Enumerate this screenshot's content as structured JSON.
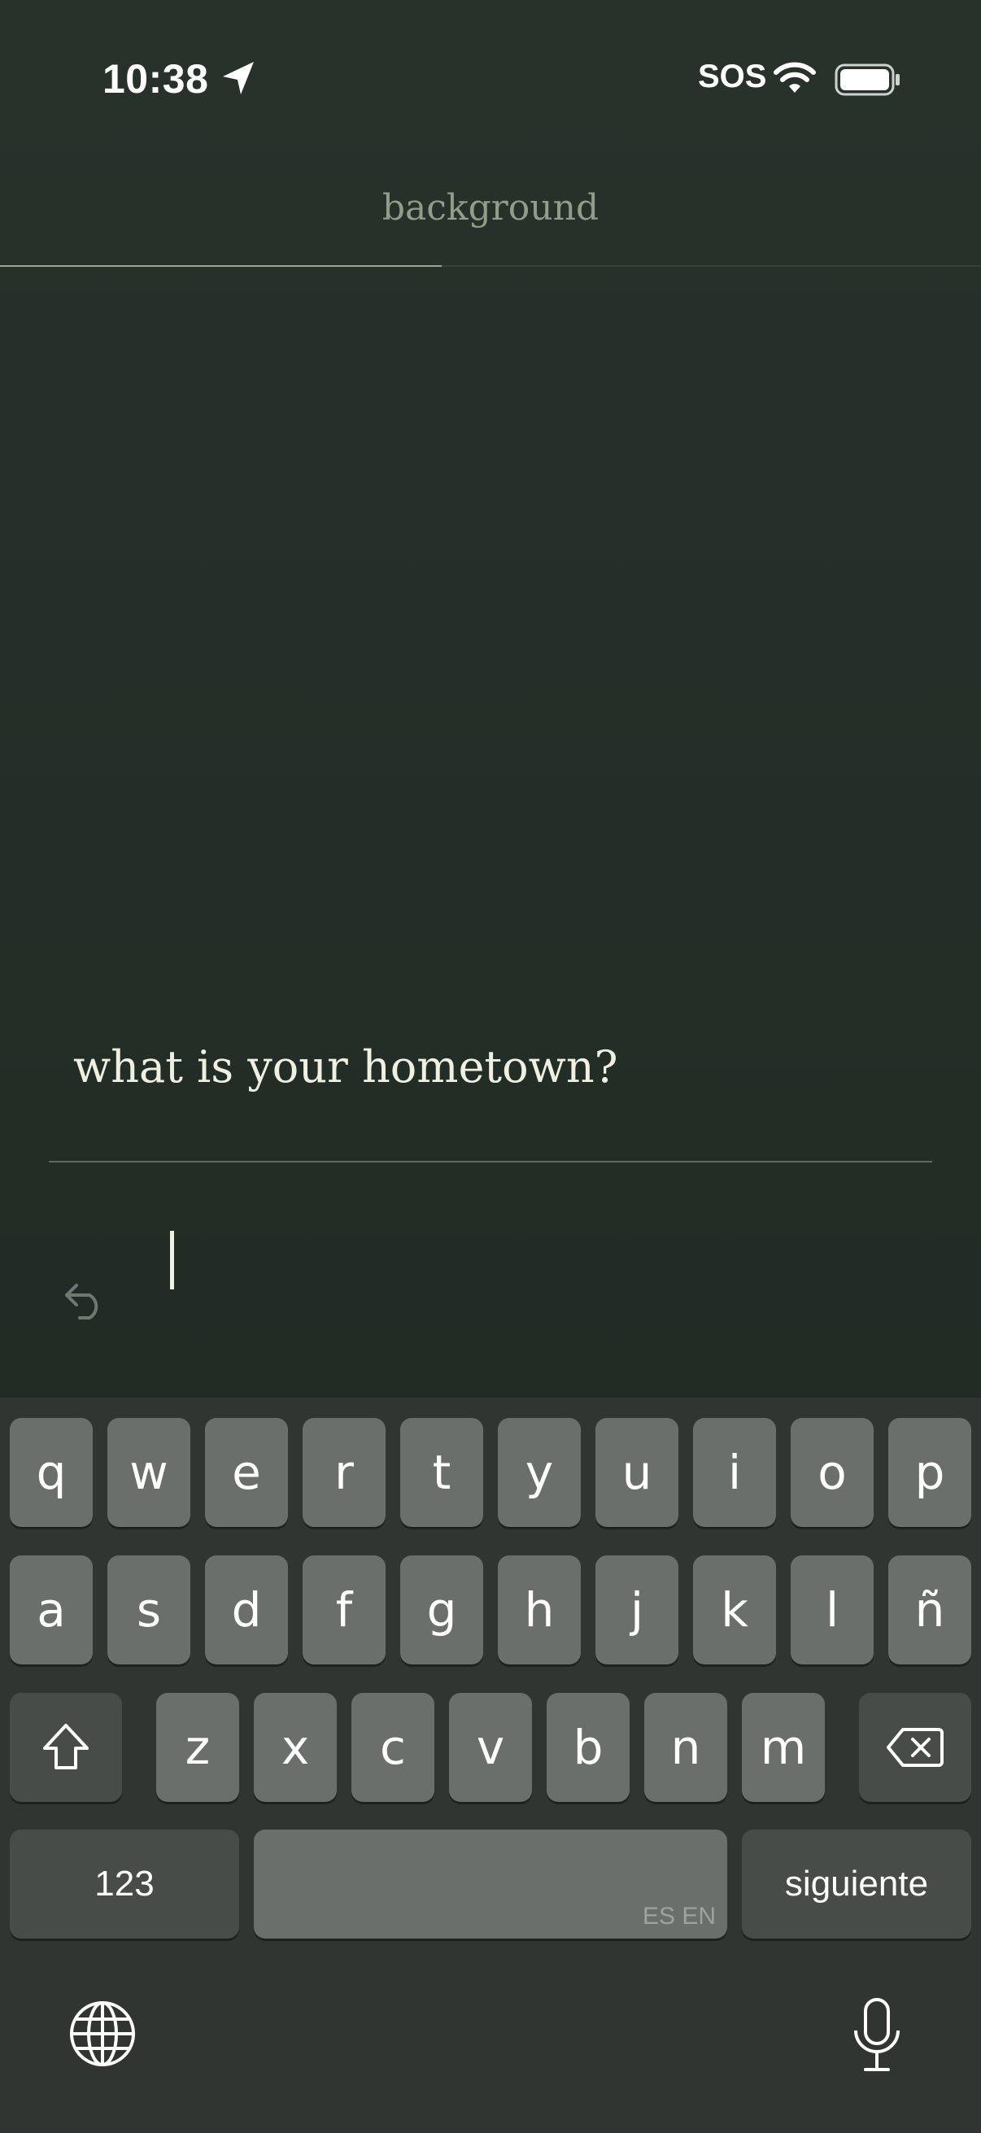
{
  "status_bar": {
    "time": "10:38",
    "sos": "SOS",
    "location_icon": "location-arrow-icon",
    "wifi_icon": "wifi-icon",
    "battery_icon": "battery-icon"
  },
  "header": {
    "title": "background",
    "progress": 0.45
  },
  "question": {
    "text": "what is your hometown?"
  },
  "answer": {
    "value": "",
    "undo_icon": "undo-icon"
  },
  "keyboard": {
    "row1": [
      "q",
      "w",
      "e",
      "r",
      "t",
      "y",
      "u",
      "i",
      "o",
      "p"
    ],
    "row2": [
      "a",
      "s",
      "d",
      "f",
      "g",
      "h",
      "j",
      "k",
      "l",
      "ñ"
    ],
    "row3": [
      "z",
      "x",
      "c",
      "v",
      "b",
      "n",
      "m"
    ],
    "numbers_label": "123",
    "space_languages": "ES EN",
    "return_label": "siguiente",
    "shift_icon": "shift-icon",
    "delete_icon": "delete-icon",
    "globe_icon": "globe-icon",
    "mic_icon": "microphone-icon"
  },
  "colors": {
    "background": "#25302a",
    "header_text": "#8f9e88",
    "question_text": "#eef0e2",
    "key": "#6a6f6c",
    "key_dark": "#474c49",
    "keyboard_bg": "#303532"
  }
}
